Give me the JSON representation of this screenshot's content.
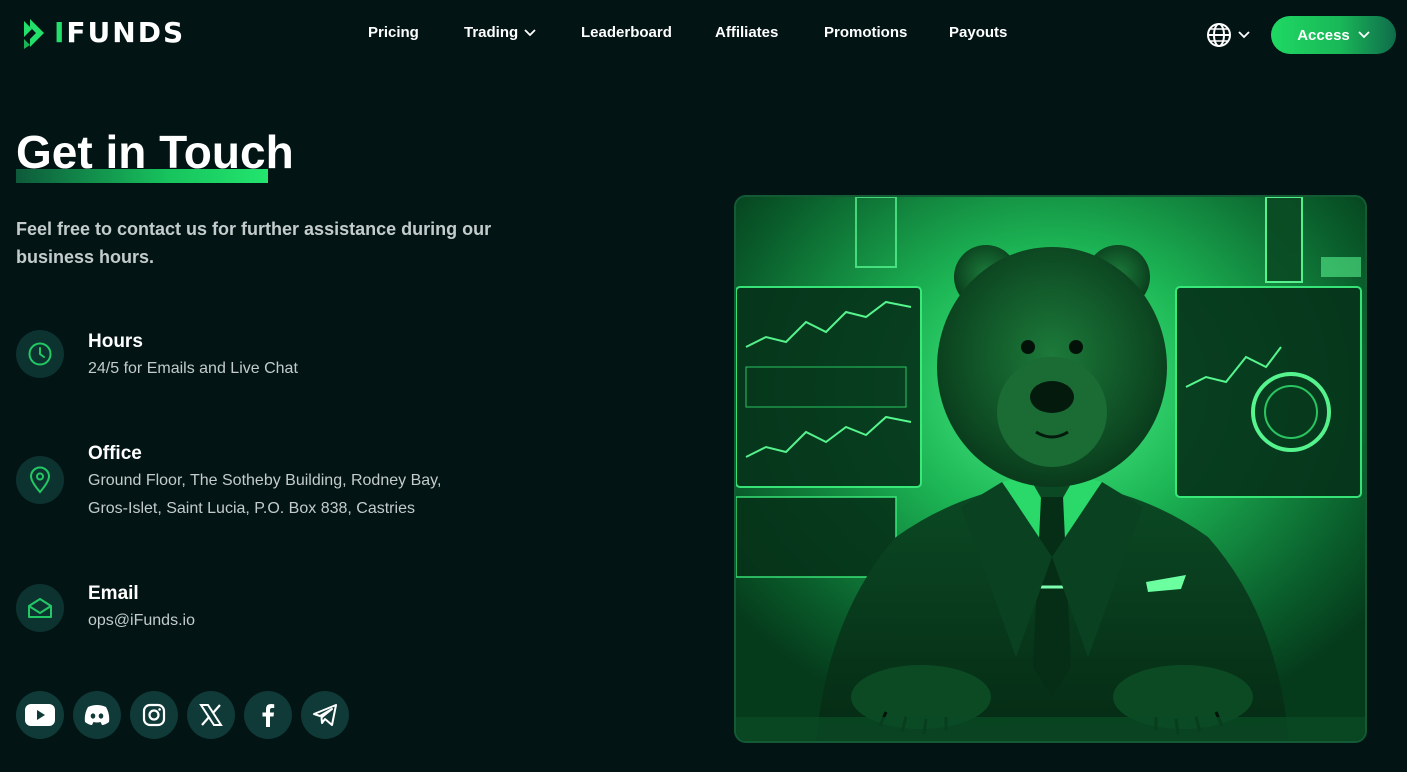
{
  "brand": {
    "name_accent": "I",
    "name_rest": "FUNDS",
    "accent_color": "#22e06b"
  },
  "nav": {
    "items": [
      {
        "label": "Pricing",
        "has_dropdown": false
      },
      {
        "label": "Trading",
        "has_dropdown": true
      },
      {
        "label": "Leaderboard",
        "has_dropdown": false
      },
      {
        "label": "Affiliates",
        "has_dropdown": false
      },
      {
        "label": "Promotions",
        "has_dropdown": false
      },
      {
        "label": "Payouts",
        "has_dropdown": false
      }
    ],
    "language_icon": "globe-icon",
    "access_label": "Access"
  },
  "contact": {
    "title": "Get in Touch",
    "intro": "Feel free to contact us for further assistance during our business hours.",
    "hours": {
      "label": "Hours",
      "text": "24/5 for Emails and Live Chat",
      "icon": "clock-icon"
    },
    "office": {
      "label": "Office",
      "line1": "Ground Floor, The Sotheby Building, Rodney Bay,",
      "line2": "Gros-Islet, Saint Lucia, P.O. Box 838, Castries",
      "icon": "location-pin-icon"
    },
    "email": {
      "label": "Email",
      "text": "ops@iFunds.io",
      "icon": "envelope-icon"
    }
  },
  "socials": [
    "youtube-icon",
    "discord-icon",
    "instagram-icon",
    "x-icon",
    "facebook-icon",
    "telegram-icon"
  ],
  "hero": {
    "icon": "bear-trader-illustration"
  }
}
